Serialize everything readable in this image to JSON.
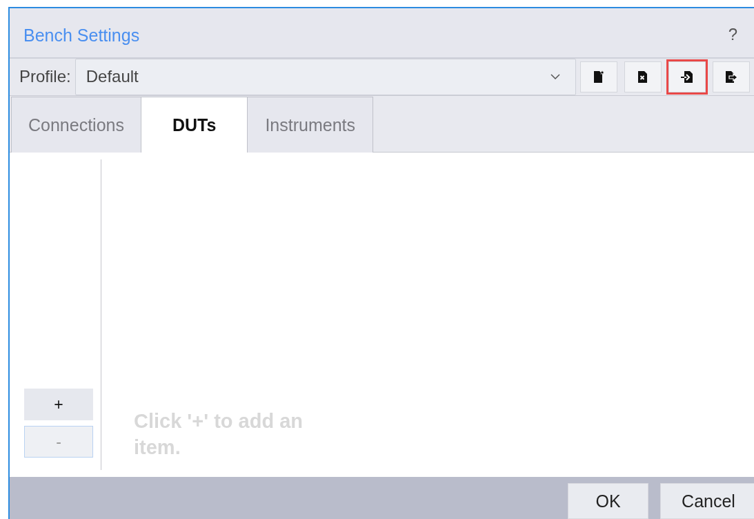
{
  "window": {
    "title": "Bench Settings",
    "help": "?"
  },
  "profile": {
    "label": "Profile:",
    "value": "Default"
  },
  "toolbar": [
    {
      "kind": "new",
      "highlighted": false
    },
    {
      "kind": "delete",
      "highlighted": false
    },
    {
      "kind": "import",
      "highlighted": true
    },
    {
      "kind": "export",
      "highlighted": false
    }
  ],
  "tabs": [
    {
      "label": "Connections",
      "selected": false
    },
    {
      "label": "DUTs",
      "selected": true
    },
    {
      "label": "Instruments",
      "selected": false
    }
  ],
  "list_buttons": [
    {
      "label": "+",
      "disabled": false
    },
    {
      "label": "-",
      "disabled": true
    }
  ],
  "empty_hint": "Click '+' to add an item.",
  "buttons": [
    "OK",
    "Cancel"
  ]
}
